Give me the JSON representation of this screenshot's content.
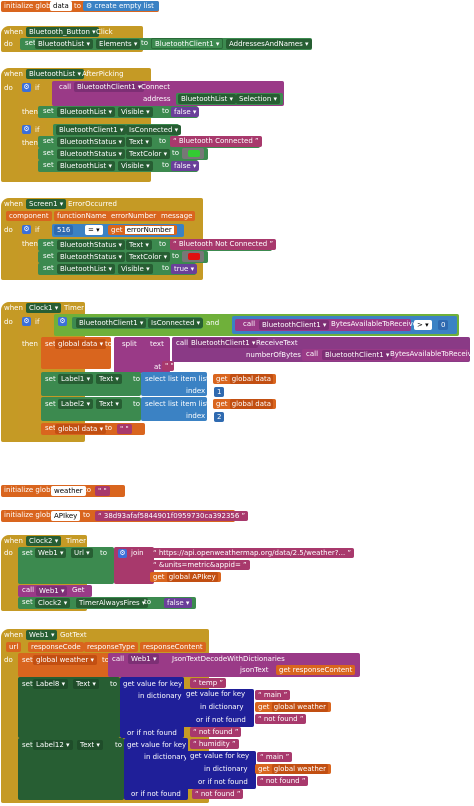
{
  "init_data": {
    "initialize": "initialize global",
    "name": "data",
    "to": "to",
    "value": "create empty list"
  },
  "button_click": {
    "when": "when",
    "component": "Bluetooth_Button",
    "event": "Click",
    "do": "do",
    "set": "set",
    "target": "BluetoothList",
    "prop": "Elements",
    "to": "to",
    "client": "BluetoothClient1",
    "addr": "AddressesAndNames"
  },
  "after_picking": {
    "when": "when",
    "component": "BluetoothList",
    "event": "AfterPicking",
    "do": "do",
    "if": "if",
    "then": "then",
    "call": "call",
    "client": "BluetoothClient1",
    "method": "Connect",
    "address": "address",
    "list": "BluetoothList",
    "selection": "Selection",
    "set": "set",
    "to": "to",
    "visible": "Visible",
    "false": "false",
    "isconnected": "IsConnected",
    "status": "BluetoothStatus",
    "text": "Text",
    "connected": "Bluetooth Connected",
    "textcolor": "TextColor",
    "color_green": "#33cc33"
  },
  "error": {
    "when": "when",
    "component": "Screen1",
    "event": "ErrorOccurred",
    "params": [
      "component",
      "functionName",
      "errorNumber",
      "message"
    ],
    "do": "do",
    "if": "if",
    "then": "then",
    "num": "516",
    "eq": "=",
    "get": "get",
    "errnum": "errorNumber",
    "set": "set",
    "to": "to",
    "status": "BluetoothStatus",
    "text": "Text",
    "not_connected": "Bluetooth Not Connected",
    "textcolor": "TextColor",
    "color_red": "#e01010",
    "list": "BluetoothList",
    "visible": "Visible",
    "true": "true"
  },
  "clock1": {
    "when": "when",
    "component": "Clock1",
    "event": "Timer",
    "do": "do",
    "if": "if",
    "then": "then",
    "client": "BluetoothClient1",
    "isconnected": "IsConnected",
    "and": "and",
    "call": "call",
    "bytes": "BytesAvailableToReceive",
    "gt": ">",
    "zero": "0",
    "set": "set",
    "global_data": "global data",
    "to": "to",
    "split": "split",
    "text": "text",
    "at": "at",
    "receive": "ReceiveText",
    "numbytes": "numberOfBytes",
    "label1": "Label1",
    "label2": "Label2",
    "textprop": "Text",
    "select": "select list item  list",
    "get": "get",
    "index": "index",
    "idx1": "1",
    "idx2": "2",
    "quote": "\" \""
  },
  "init_weather": {
    "initialize": "initialize global",
    "name": "weather",
    "to": "to",
    "value": "\" \""
  },
  "init_apikey": {
    "initialize": "initialize global",
    "name": "APIkey",
    "to": "to",
    "value": "38d93afaf5844901f0959730ca392356"
  },
  "clock2": {
    "when": "when",
    "component": "Clock2",
    "event": "Timer",
    "do": "do",
    "set": "set",
    "web": "Web1",
    "url": "Url",
    "to": "to",
    "join": "join",
    "url1": "https://api.openweathermap.org/data/2.5/weather?...",
    "url2": "&units=metric&appid=",
    "get": "get",
    "apikey": "global APIkey",
    "call": "call",
    "getm": "Get",
    "clock": "Clock2",
    "timer_fires": "TimerAlwaysFires",
    "false": "false"
  },
  "gottext": {
    "when": "when",
    "component": "Web1",
    "event": "GotText",
    "params": [
      "url",
      "responseCode",
      "responseType",
      "responseContent"
    ],
    "do": "do",
    "set": "set",
    "weather": "global weather",
    "to": "to",
    "call": "call",
    "web": "Web1",
    "decode": "JsonTextDecodeWithDictionaries",
    "jsontext": "jsonText",
    "get": "get",
    "content": "responseContent",
    "label8": "Label8",
    "label12": "Label12",
    "text": "Text",
    "gvk": "get value for key",
    "indict": "in dictionary",
    "notfound": "or if not found",
    "temp": "temp",
    "humidity": "humidity",
    "main": "main",
    "notfound_val": "not found"
  }
}
